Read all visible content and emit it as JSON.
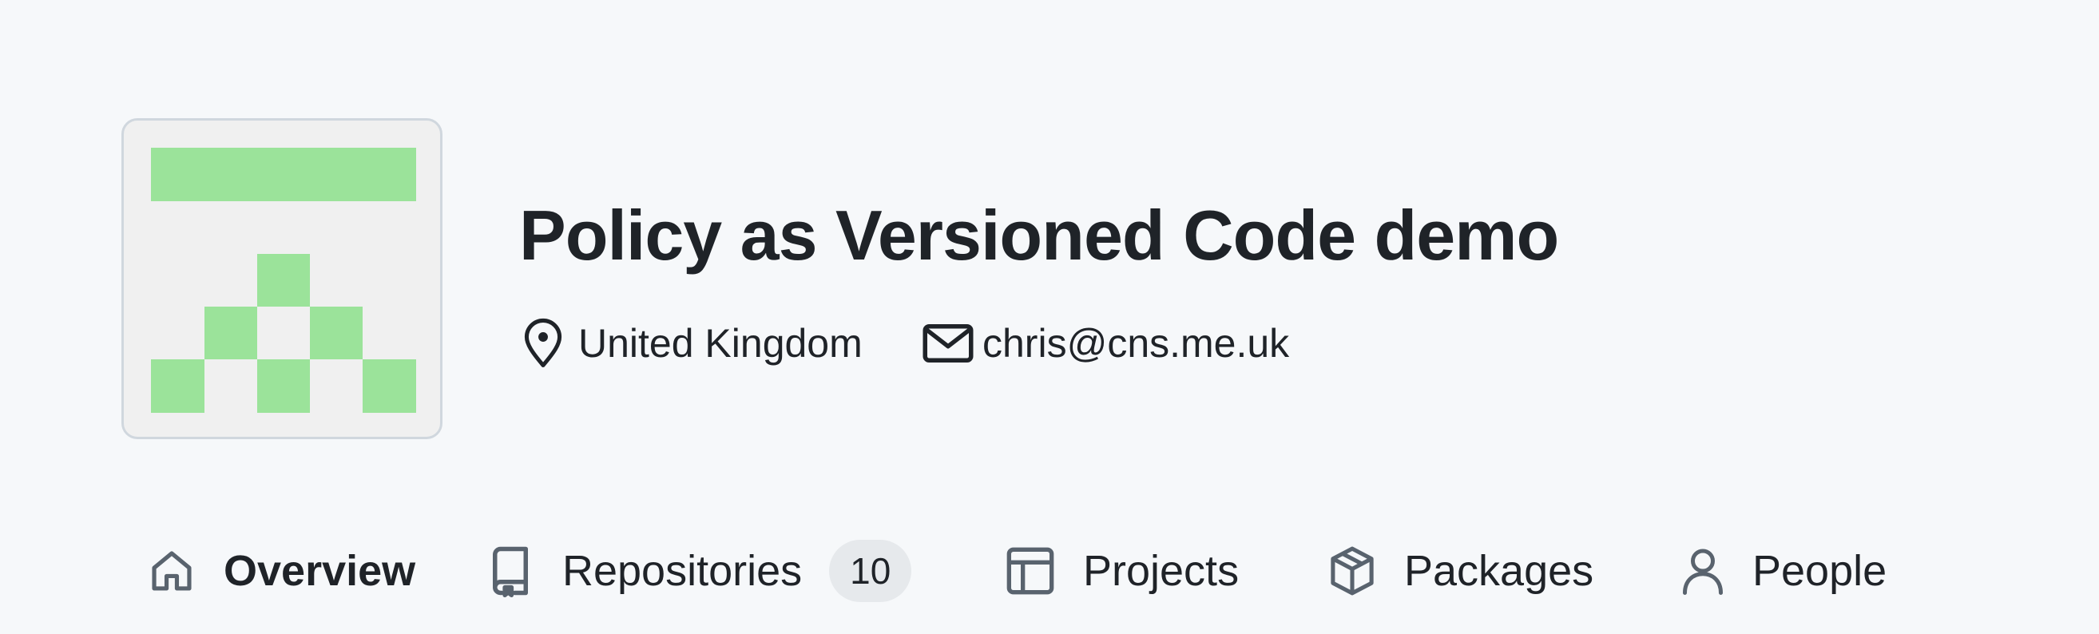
{
  "org": {
    "name": "Policy as Versioned Code demo",
    "location": "United Kingdom",
    "email": "chris@cns.me.uk"
  },
  "avatar": {
    "description_icon": "identicon",
    "fill_color": "#9be39a",
    "background_color": "#f0f0f0"
  },
  "nav": {
    "tabs": [
      {
        "label": "Overview",
        "icon": "home-icon",
        "active": true
      },
      {
        "label": "Repositories",
        "icon": "repo-icon",
        "count": "10"
      },
      {
        "label": "Projects",
        "icon": "table-icon"
      },
      {
        "label": "Packages",
        "icon": "package-icon"
      },
      {
        "label": "People",
        "icon": "person-icon"
      }
    ]
  },
  "colors": {
    "background": "#f6f8fa",
    "text": "#1f2328",
    "icon": "#59636e",
    "counter_bg": "#e6e9ec"
  }
}
